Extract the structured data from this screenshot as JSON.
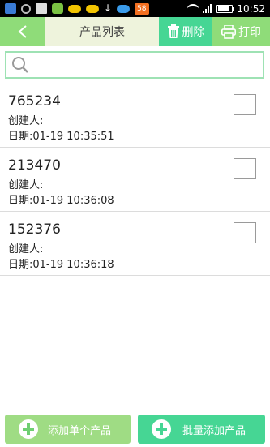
{
  "status_bar": {
    "notification_badge": "58",
    "time": "10:52",
    "download_glyph": "↓",
    "icons": [
      "app-icon",
      "app-icon",
      "image-icon",
      "app-icon",
      "cloud-icon",
      "cloud-icon",
      "download-icon",
      "cloud-icon",
      "wifi-icon",
      "signal-icon",
      "battery-icon"
    ]
  },
  "header": {
    "back_glyph": "<",
    "title": "产品列表",
    "delete_label": "删除",
    "print_label": "打印",
    "accent_color": "#8fdc79",
    "delete_bg": "#46d694",
    "title_bg": "#eef3dc"
  },
  "search": {
    "value": "",
    "placeholder": "",
    "border_color": "#9ee2b4"
  },
  "products": [
    {
      "code": "765234",
      "creator": "创建人:",
      "date": "日期:01-19 10:35:51",
      "checked": false
    },
    {
      "code": "213470",
      "creator": "创建人:",
      "date": "日期:01-19 10:36:08",
      "checked": false
    },
    {
      "code": "152376",
      "creator": "创建人:",
      "date": "日期:01-19 10:36:18",
      "checked": false
    }
  ],
  "bottom": {
    "add_single_label": "添加单个产品",
    "add_batch_label": "批量添加产品",
    "add_single_bg": "#9fdc84",
    "add_batch_bg": "#46d694"
  }
}
